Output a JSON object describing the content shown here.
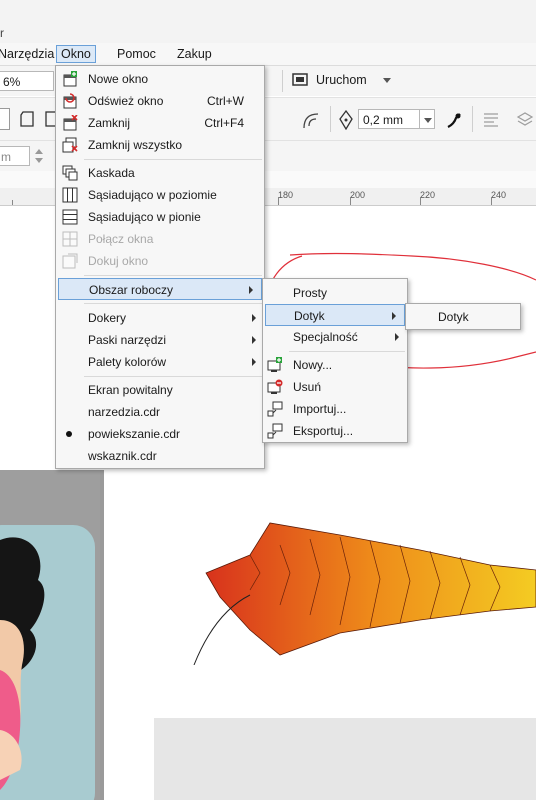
{
  "window": {
    "title_fragment": "r"
  },
  "menubar": {
    "items": [
      {
        "label": "Narzędzia"
      },
      {
        "label": "Okno"
      },
      {
        "label": "Pomoc"
      },
      {
        "label": "Zakup"
      }
    ]
  },
  "toolbar": {
    "zoom_value": "6%",
    "launch_label": "Uruchom",
    "outline_width": "0,2 mm",
    "units_value": "m"
  },
  "ruler": {
    "labels": [
      "180",
      "200",
      "220",
      "240"
    ]
  },
  "okno_menu": {
    "new_window": "Nowe okno",
    "refresh_window": "Odśwież okno",
    "refresh_shortcut": "Ctrl+W",
    "close": "Zamknij",
    "close_shortcut": "Ctrl+F4",
    "close_all": "Zamknij wszystko",
    "cascade": "Kaskada",
    "tile_horizontal": "Sąsiadująco w poziomie",
    "tile_vertical": "Sąsiadująco w pionie",
    "combine": "Połącz okna",
    "dock": "Dokuj okno",
    "workspace": "Obszar roboczy",
    "dockers": "Dokery",
    "toolbars": "Paski narzędzi",
    "palettes": "Palety kolorów",
    "welcome": "Ekran powitalny",
    "doc1": "narzedzia.cdr",
    "doc2": "powiekszanie.cdr",
    "doc3": "wskaznik.cdr"
  },
  "workspace_menu": {
    "simple": "Prosty",
    "touch": "Dotyk",
    "special": "Specjalność",
    "new": "Nowy...",
    "delete": "Usuń",
    "import": "Importuj...",
    "export": "Eksportuj..."
  },
  "touch_menu": {
    "touch_item": "Dotyk"
  },
  "colors": {
    "highlight": "#dbe8f7",
    "highlight_border": "#6aa0d8",
    "annotation_red": "#e0303a",
    "feather_start": "#e03a1e",
    "feather_end": "#f2c21a"
  }
}
